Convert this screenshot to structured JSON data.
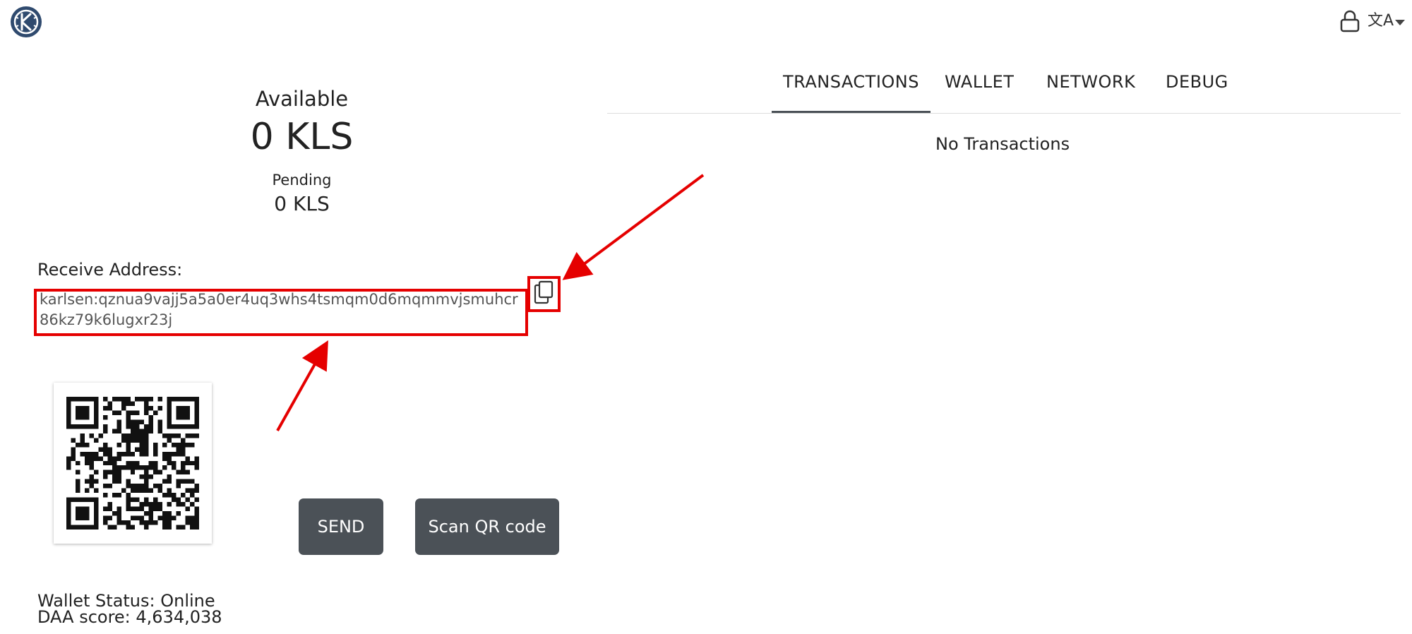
{
  "header": {
    "logo_icon": "karlsen-logo-icon",
    "lock_icon": "lock-icon",
    "language_icon": "translate-icon",
    "language_glyph": "文A"
  },
  "balance": {
    "available_label": "Available",
    "available_value": "0 KLS",
    "pending_label": "Pending",
    "pending_value": "0 KLS"
  },
  "receive": {
    "label": "Receive Address:",
    "address": "karlsen:qznua9vajj5a5a0er4uq3whs4tsmqm0d6mqmmvjsmuhcr86kz79k6lugxr23j",
    "copy_icon": "copy-icon"
  },
  "actions": {
    "send_label": "SEND",
    "scan_label": "Scan QR code"
  },
  "status": {
    "wallet_status": "Wallet Status: Online",
    "daa_score": "DAA score: 4,634,038"
  },
  "tabs": [
    {
      "label": "TRANSACTIONS",
      "active": true
    },
    {
      "label": "WALLET",
      "active": false
    },
    {
      "label": "NETWORK",
      "active": false
    },
    {
      "label": "DEBUG",
      "active": false
    }
  ],
  "transactions": {
    "empty_text": "No Transactions"
  },
  "colors": {
    "button_bg": "#4b5157",
    "annotation_red": "#e50000",
    "logo_blue": "#2f4a6e"
  }
}
